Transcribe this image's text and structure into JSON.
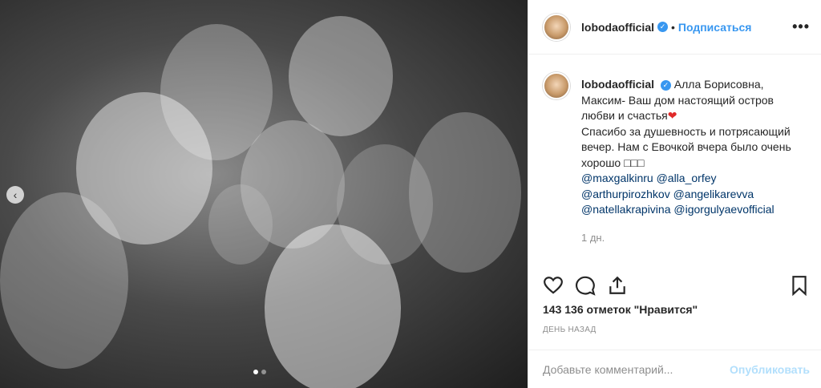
{
  "post": {
    "dots_count": 2,
    "active_dot": 0
  },
  "header": {
    "username": "lobodaofficial",
    "separator": "•",
    "follow_label": "Подписаться",
    "more_label": "•••"
  },
  "caption": {
    "username": "lobodaofficial",
    "text_1": "Алла Борисовна, Максим- Ваш дом настоящий остров любви и счастья",
    "heart": "❤",
    "text_2": "Спасибо за душевность и потрясающий вечер. Нам с Евочкой вчера было очень хорошо □□□",
    "mentions": [
      "@maxgalkinru",
      "@alla_orfey",
      "@arthurpirozhkov",
      "@angelikarevva",
      "@natellakrapivina",
      "@igorgulyaevofficial"
    ],
    "time_ago": "1 дн."
  },
  "stats": {
    "likes_text": "143 136 отметок \"Нравится\"",
    "date_text": "ДЕНЬ НАЗАД"
  },
  "comment_box": {
    "placeholder": "Добавьте комментарий...",
    "post_label": "Опубликовать"
  },
  "colors": {
    "accent": "#3897f0",
    "mention": "#003569",
    "muted": "#8e8e8e",
    "post_disabled": "#b2dffc"
  }
}
